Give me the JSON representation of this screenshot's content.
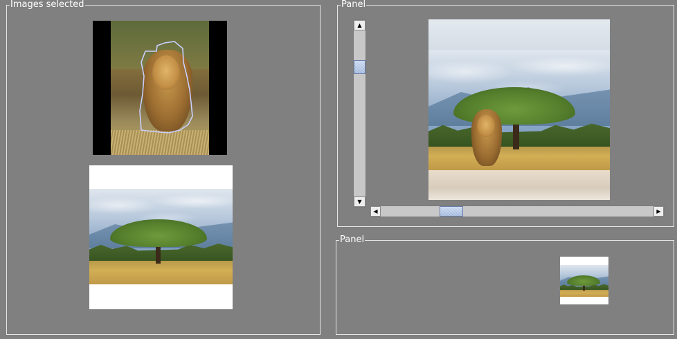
{
  "panels": {
    "images_selected": {
      "title": "Images selected"
    },
    "viewer": {
      "title": "Panel"
    },
    "preview": {
      "title": "Panel"
    }
  },
  "scrollbars": {
    "vertical": {
      "up_icon": "arrow-up-icon",
      "down_icon": "arrow-down-icon",
      "position": 0.28
    },
    "horizontal": {
      "left_icon": "arrow-left-icon",
      "right_icon": "arrow-right-icon",
      "position": 0.25
    }
  },
  "images": [
    {
      "subject": "lion walking",
      "selected": true,
      "outline_color": "#c8d0ff"
    },
    {
      "subject": "acacia tree in savanna"
    },
    {
      "subject": "lion in front of acacia tree"
    },
    {
      "subject": "acacia tree thumbnail"
    }
  ],
  "colors": {
    "background": "#808080",
    "border": "#e6e6e6",
    "selection_outline": "#c8d0ff",
    "scroll_thumb": "#aabfe2"
  }
}
